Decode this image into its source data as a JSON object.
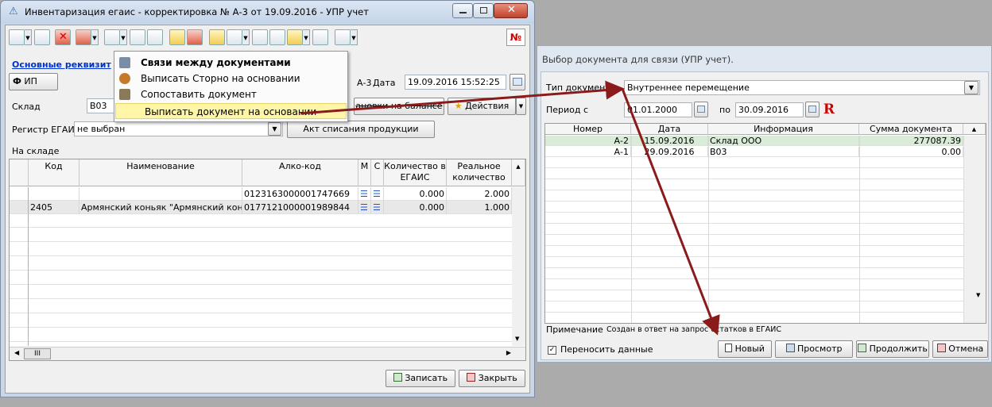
{
  "main_window": {
    "title": "Инвентаризация егаис - корректировка № А-3 от 19.09.2016 - УПР учет",
    "no_button": "№",
    "tab_link": "Основные реквизит",
    "org_icon": "Ф",
    "org_value": "ИП",
    "number_value": "А-3",
    "date_label": "Дата",
    "date_value": "19.09.2016 15:52:25",
    "warehouse_label": "Склад",
    "warehouse_value": "В03",
    "balance_button": "ановки на балансе",
    "actions_button": "Действия",
    "register_label": "Регистр ЕГАИС",
    "register_value": "не выбран",
    "writeoff_button": "Акт списания продукции",
    "stock_label": "На складе",
    "grid": {
      "columns": [
        "Код",
        "Наименование",
        "Алко-код",
        "М",
        "С",
        "Количество в ЕГАИС",
        "Реальное количество"
      ],
      "rows": [
        {
          "code": "",
          "name": "",
          "alco": "0123163000001747669",
          "qty": "0.000",
          "real": "2.000"
        },
        {
          "code": "2405",
          "name": "Армянский коньяк \"Армянский конья",
          "alco": "0177121000001989844",
          "qty": "0.000",
          "real": "1.000"
        }
      ]
    },
    "scroll_label": "III",
    "save_button": "Записать",
    "close_button": "Закрыть"
  },
  "context_menu": {
    "items": [
      {
        "label": "Связи между документами",
        "icon": "links-icon"
      },
      {
        "label": "Выписать Сторно на основании",
        "icon": "storno-icon"
      },
      {
        "label": "Сопоставить документ",
        "icon": "compare-icon"
      },
      {
        "label": "Выписать документ на основании",
        "icon": ""
      }
    ]
  },
  "select_window": {
    "title": "Выбор документа для связи (УПР учет).",
    "doc_type_label": "Тип документа",
    "doc_type_value": "Внутреннее перемещение",
    "period_label": "Период с",
    "period_from": "01.01.2000",
    "period_to_label": "по",
    "period_to": "30.09.2016",
    "grid": {
      "columns": [
        "Номер",
        "Дата",
        "Информация",
        "Сумма документа"
      ],
      "rows": [
        {
          "num": "А-2",
          "date": "15.09.2016",
          "info": "Склад ООО",
          "sum": "277087.39"
        },
        {
          "num": "А-1",
          "date": "29.09.2016",
          "info": "В03",
          "sum": "0.00"
        }
      ]
    },
    "note_label": "Примечание",
    "note_value": "Создан в ответ на запрос остатков в ЕГАИС",
    "transfer_label": "Переносить данные",
    "new_button": "Новый",
    "view_button": "Просмотр",
    "continue_button": "Продолжить",
    "cancel_button": "Отмена"
  },
  "colors": {
    "arrow": "#8b1a1a",
    "highlight_row": "#d8ecd8",
    "menu_highlight": "#fff6a8"
  }
}
